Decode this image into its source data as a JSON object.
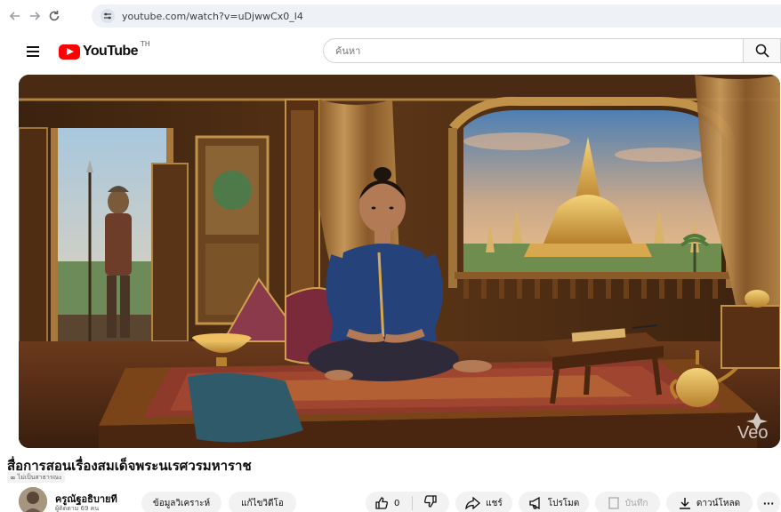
{
  "browser": {
    "url": "youtube.com/watch?v=uDjwwCx0_l4"
  },
  "header": {
    "logo_text": "YouTube",
    "country_code": "TH",
    "search_placeholder": "ค้นหา"
  },
  "video": {
    "watermark": "Veo",
    "title": "สื่อการสอนเรื่องสมเด็จพระนเรศวรมหาราช",
    "badge": "ไม่เป็นสาธารณะ"
  },
  "channel": {
    "name": "ครูณัฐอธิบายที",
    "subscribers": "ผู้ติดตาม 69 คน"
  },
  "actions": {
    "analytics_label": "ข้อมูลวิเคราะห์",
    "edit_label": "แก้ไขวิดีโอ",
    "like_count": "0",
    "share_label": "แชร์",
    "promote_label": "โปรโมต",
    "save_label": "บันทึก",
    "download_label": "ดาวน์โหลด",
    "more_label": "···"
  },
  "icons": {
    "back": "arrow-left-icon",
    "forward": "arrow-right-icon",
    "reload": "reload-icon",
    "site_info": "tune-icon",
    "menu": "hamburger-menu-icon",
    "search": "search-icon",
    "like": "thumbs-up-icon",
    "dislike": "thumbs-down-icon",
    "share": "share-arrow-icon",
    "promote": "megaphone-icon",
    "save": "bookmark-icon",
    "download": "download-icon"
  },
  "colors": {
    "brand_red": "#ff0000",
    "pill_bg": "#f2f2f2",
    "text_primary": "#0f0f0f",
    "text_secondary": "#606060"
  }
}
